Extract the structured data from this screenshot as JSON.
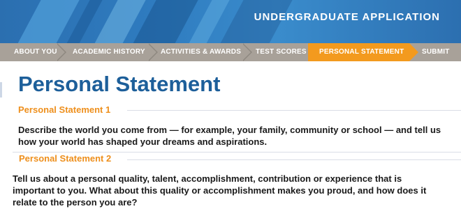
{
  "header": {
    "title": "UNDERGRADUATE APPLICATION"
  },
  "steps": [
    {
      "label": "ABOUT YOU",
      "active": false
    },
    {
      "label": "ACADEMIC HISTORY",
      "active": false
    },
    {
      "label": "ACTIVITIES & AWARDS",
      "active": false
    },
    {
      "label": "TEST SCORES",
      "active": false
    },
    {
      "label": "PERSONAL STATEMENT",
      "active": true
    },
    {
      "label": "SUBMIT",
      "active": false
    }
  ],
  "page": {
    "title": "Personal Statement"
  },
  "sections": [
    {
      "heading": "Personal Statement 1",
      "prompt_line1": "Describe the world you come from — for example, your family, community or school — and tell us",
      "prompt_line2": "how your world has shaped your dreams and aspirations."
    },
    {
      "heading": "Personal Statement 2",
      "prompt_line1": "Tell us about a personal quality, talent, accomplishment, contribution or experience that is",
      "prompt_line2": "important to you. What about this quality or accomplishment makes you proud, and how does it",
      "prompt_line3": "relate to the person you are?"
    }
  ],
  "colors": {
    "brand_blue": "#1d5f9a",
    "accent_orange": "#f39a1e",
    "nav_gray": "#a8a199"
  }
}
